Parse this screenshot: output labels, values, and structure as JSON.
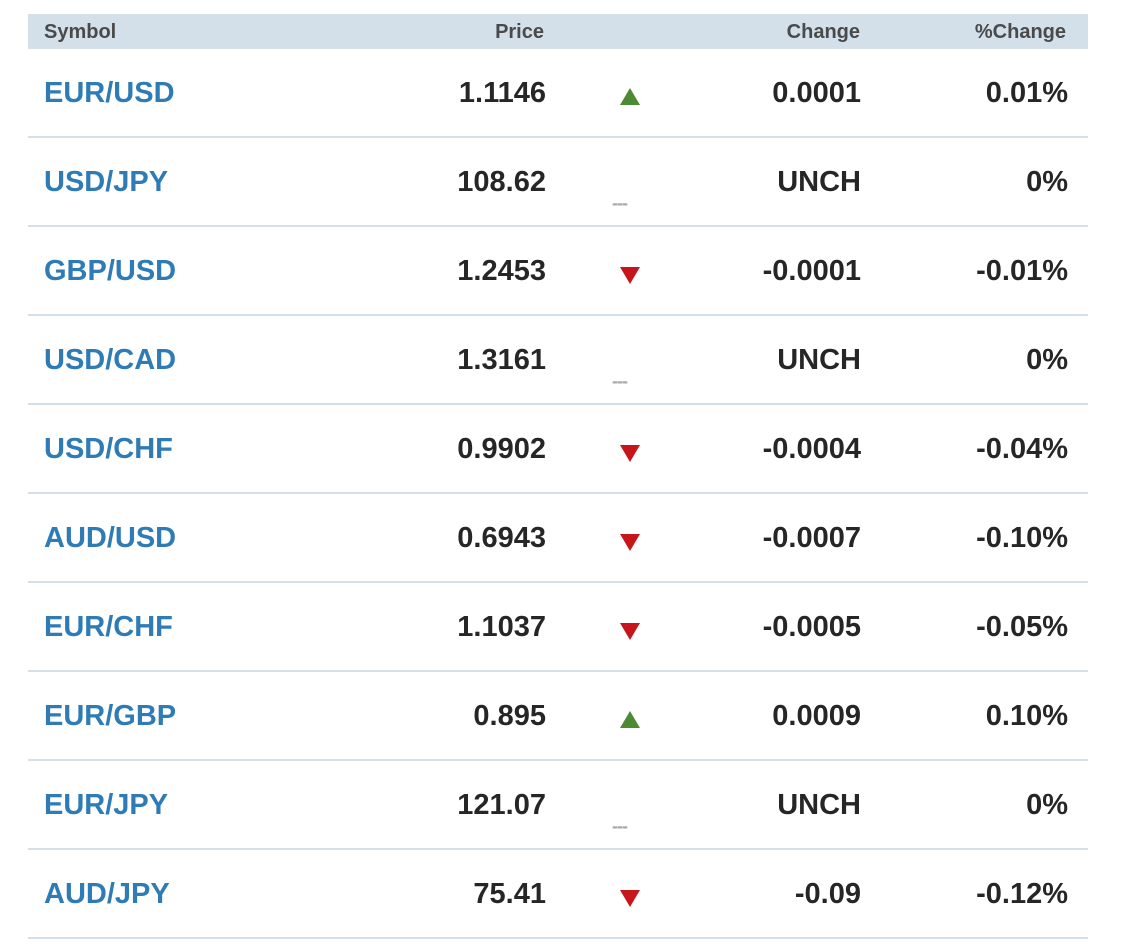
{
  "header": {
    "symbol": "Symbol",
    "price": "Price",
    "change": "Change",
    "pct_change": "%Change"
  },
  "colors": {
    "header_bg": "#d3e0ea",
    "symbol_link": "#2e7bb6",
    "up": "#4e8a34",
    "down": "#c6151b",
    "unchanged": "#a9a9a9"
  },
  "icons": {
    "up": "triangle-up-icon",
    "down": "triangle-down-icon",
    "unchanged": "dash-icon"
  },
  "rows": [
    {
      "symbol": "EUR/USD",
      "price": "1.1146",
      "direction": "up",
      "indicator": "",
      "change": "0.0001",
      "pct": "0.01%"
    },
    {
      "symbol": "USD/JPY",
      "price": "108.62",
      "direction": "unchanged",
      "indicator": "---",
      "change": "UNCH",
      "pct": "0%"
    },
    {
      "symbol": "GBP/USD",
      "price": "1.2453",
      "direction": "down",
      "indicator": "",
      "change": "-0.0001",
      "pct": "-0.01%"
    },
    {
      "symbol": "USD/CAD",
      "price": "1.3161",
      "direction": "unchanged",
      "indicator": "---",
      "change": "UNCH",
      "pct": "0%"
    },
    {
      "symbol": "USD/CHF",
      "price": "0.9902",
      "direction": "down",
      "indicator": "",
      "change": "-0.0004",
      "pct": "-0.04%"
    },
    {
      "symbol": "AUD/USD",
      "price": "0.6943",
      "direction": "down",
      "indicator": "",
      "change": "-0.0007",
      "pct": "-0.10%"
    },
    {
      "symbol": "EUR/CHF",
      "price": "1.1037",
      "direction": "down",
      "indicator": "",
      "change": "-0.0005",
      "pct": "-0.05%"
    },
    {
      "symbol": "EUR/GBP",
      "price": "0.895",
      "direction": "up",
      "indicator": "",
      "change": "0.0009",
      "pct": "0.10%"
    },
    {
      "symbol": "EUR/JPY",
      "price": "121.07",
      "direction": "unchanged",
      "indicator": "---",
      "change": "UNCH",
      "pct": "0%"
    },
    {
      "symbol": "AUD/JPY",
      "price": "75.41",
      "direction": "down",
      "indicator": "",
      "change": "-0.09",
      "pct": "-0.12%"
    }
  ]
}
